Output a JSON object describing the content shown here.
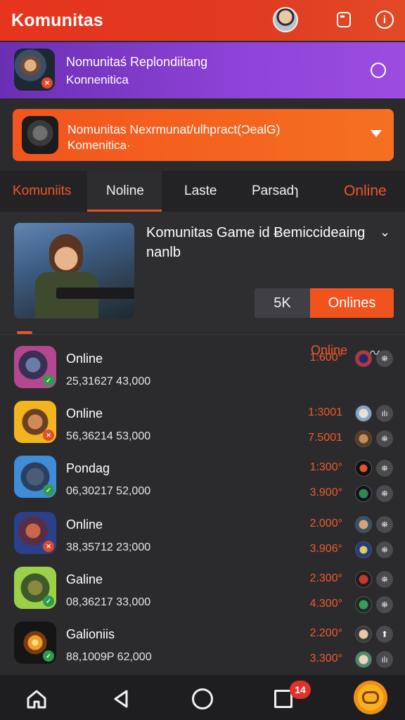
{
  "header": {
    "title": "Komunitas"
  },
  "banner_purple": {
    "line1": "Nomunitaś Replondiitang",
    "line2": "Konnenitica"
  },
  "banner_orange": {
    "line1": "Nomunitas Nexrmunat/ulhpract(ƆealG)",
    "line2": "Komenitica·"
  },
  "tabs": [
    {
      "label": "Komuniits"
    },
    {
      "label": "Noline"
    },
    {
      "label": "Laste"
    },
    {
      "label": "Parsadɿ"
    },
    {
      "label": "Online"
    }
  ],
  "featured": {
    "title": "Komunitas Game id Ƀemiccideaing",
    "subtitle": "nanlb",
    "count": "5K",
    "button": "Onlines"
  },
  "list_header": {
    "status": "Online",
    "wave": "〰"
  },
  "rows": [
    {
      "name": "Online",
      "stats": "25,31627 43,000",
      "v1": "1:600°",
      "v2": "",
      "g1": "⛯",
      "g2": ""
    },
    {
      "name": "Online",
      "stats": "56,36214 53,000",
      "v1": "1:3001",
      "v2": "7.5001",
      "g1": "ılı",
      "g2": "⛯"
    },
    {
      "name": "Pondag",
      "stats": "06,30217 52,000",
      "v1": "1:300°",
      "v2": "3.900°",
      "g1": "⛯",
      "g2": "⛯"
    },
    {
      "name": "Online",
      "stats": "38,35712 23;000",
      "v1": "2.000°",
      "v2": "3.906°",
      "g1": "⛯",
      "g2": "⛯"
    },
    {
      "name": "Galine",
      "stats": "08,36217 33,000",
      "v1": "2.300°",
      "v2": "4.300°",
      "g1": "⛯",
      "g2": "⛯"
    },
    {
      "name": "Galioniis",
      "stats": "88,1009P 62,000",
      "v1": "2.200°",
      "v2": "3.300°",
      "g1": "⬆",
      "g2": "ılı"
    }
  ],
  "nav": {
    "notif_count": "14"
  },
  "colors": {
    "accent": "#f0552a",
    "header": "#e6341d",
    "purple": "#8f43d8",
    "bg": "#2b2b2d"
  }
}
